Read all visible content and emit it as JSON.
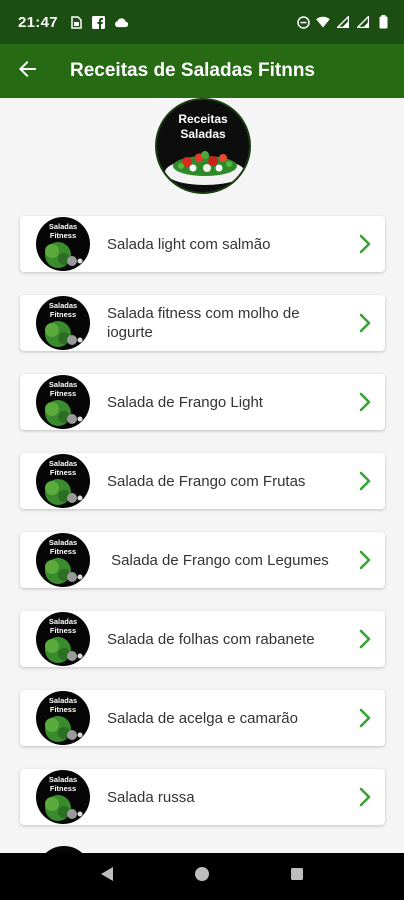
{
  "status_bar": {
    "time": "21:47"
  },
  "app_bar": {
    "title": "Receitas de Saladas Fitnns"
  },
  "logo": {
    "line1": "Receitas",
    "line2": "Saladas"
  },
  "thumbnail": {
    "line1": "Saladas",
    "line2": "Fitness"
  },
  "recipes": [
    {
      "label": "Salada light com salmão"
    },
    {
      "label": "Salada fitness com molho de iogurte"
    },
    {
      "label": "Salada de Frango Light"
    },
    {
      "label": "Salada de Frango com Frutas"
    },
    {
      "label": " Salada de Frango com Legumes"
    },
    {
      "label": "Salada de folhas com rabanete"
    },
    {
      "label": "Salada de acelga e camarão"
    },
    {
      "label": "Salada russa"
    }
  ],
  "colors": {
    "status_bar": "#1c4d12",
    "app_bar": "#276a14",
    "chevron": "#3aa135"
  }
}
